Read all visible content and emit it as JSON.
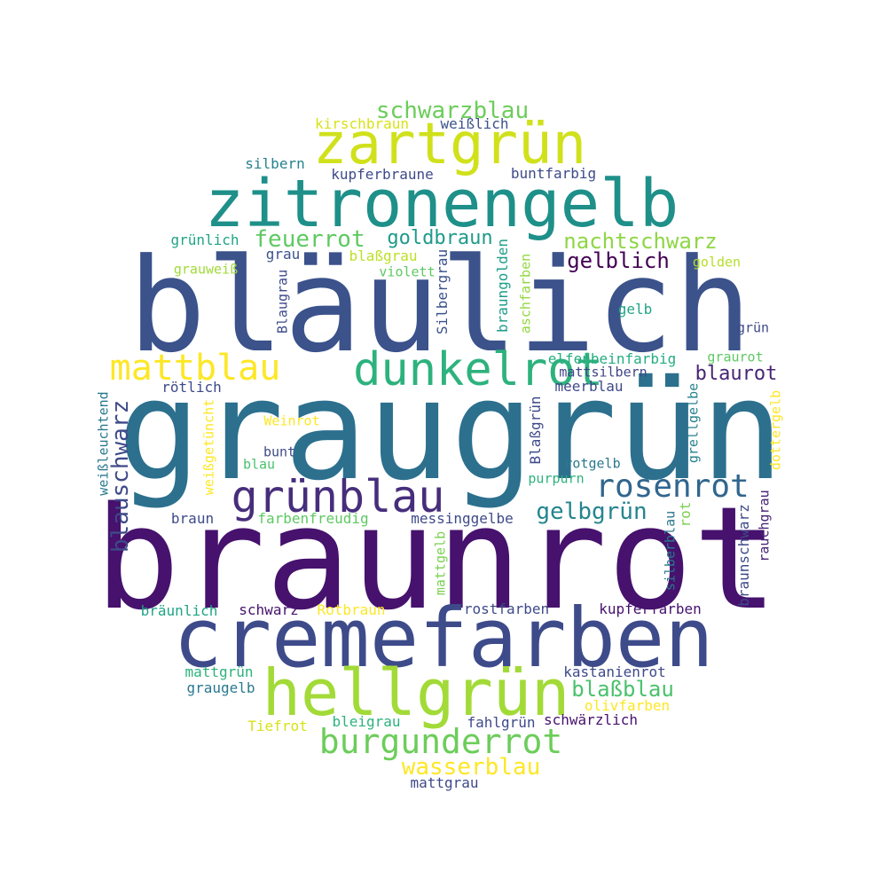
{
  "words": [
    {
      "id": "braunrot",
      "text": "braunrot",
      "color": "#46126d"
    },
    {
      "id": "graugruen",
      "text": "graugrün",
      "color": "#2c708e"
    },
    {
      "id": "blaeulich",
      "text": "bläulich",
      "color": "#3b528b"
    },
    {
      "id": "cremefarben",
      "text": "cremefarben",
      "color": "#3e4b8a"
    },
    {
      "id": "zitronengelb",
      "text": "zitronengelb",
      "color": "#1e9089"
    },
    {
      "id": "hellgruen",
      "text": "hellgrün",
      "color": "#a2da37"
    },
    {
      "id": "zartgruen",
      "text": "zartgrün",
      "color": "#d0e11c"
    },
    {
      "id": "dunkelrot",
      "text": "dunkelrot",
      "color": "#2db27d"
    },
    {
      "id": "gruenblau",
      "text": "grünblau",
      "color": "#472e7c"
    },
    {
      "id": "mattblau",
      "text": "mattblau",
      "color": "#fde725"
    },
    {
      "id": "burgunderrot",
      "text": "burgunderrot",
      "color": "#6ccd5a"
    },
    {
      "id": "rosenrot",
      "text": "rosenrot",
      "color": "#31668e"
    },
    {
      "id": "schwarzblau",
      "text": "schwarzblau",
      "color": "#6ccd5a"
    },
    {
      "id": "wasserblau",
      "text": "wasserblau",
      "color": "#fde725"
    },
    {
      "id": "blauschwarz",
      "text": "blauschwarz",
      "color": "#3e4a89"
    },
    {
      "id": "gelbgruen",
      "text": "gelbgrün",
      "color": "#25858e"
    },
    {
      "id": "nachtschwarz",
      "text": "nachtschwarz",
      "color": "#8ed645"
    },
    {
      "id": "feuerrot",
      "text": "feuerrot",
      "color": "#5ec962"
    },
    {
      "id": "goldbraun",
      "text": "goldbraun",
      "color": "#1f9a8a"
    },
    {
      "id": "gelblich",
      "text": "gelblich",
      "color": "#440154"
    },
    {
      "id": "blassblau",
      "text": "blaßblau",
      "color": "#4ac16d"
    },
    {
      "id": "blaurot",
      "text": "blaurot",
      "color": "#482475"
    },
    {
      "id": "kirschbraun",
      "text": "kirschbraun",
      "color": "#d8e219"
    },
    {
      "id": "weisslich",
      "text": "weißlich",
      "color": "#3b528b"
    },
    {
      "id": "silbern",
      "text": "silbern",
      "color": "#26828e"
    },
    {
      "id": "kupferbraune",
      "text": "kupferbraune",
      "color": "#3e4a89"
    },
    {
      "id": "buntfarbig",
      "text": "buntfarbig",
      "color": "#3e4a89"
    },
    {
      "id": "gruenlich",
      "text": "grünlich",
      "color": "#20a486"
    },
    {
      "id": "braungolden",
      "text": "braungolden",
      "color": "#1f9e89"
    },
    {
      "id": "grau",
      "text": "grau",
      "color": "#3b528b"
    },
    {
      "id": "blassgrau",
      "text": "blaßgrau",
      "color": "#bddf26"
    },
    {
      "id": "grauweiss",
      "text": "grauweiß",
      "color": "#a0da39"
    },
    {
      "id": "violett",
      "text": "violett",
      "color": "#5ec962"
    },
    {
      "id": "golden",
      "text": "golden",
      "color": "#b5de2b"
    },
    {
      "id": "silbergrau",
      "text": "Silbergrau",
      "color": "#3b528b"
    },
    {
      "id": "aschfarben",
      "text": "aschfarben",
      "color": "#93d741"
    },
    {
      "id": "blaugrau",
      "text": "Blaugrau",
      "color": "#3e4a89"
    },
    {
      "id": "gelb",
      "text": "gelb",
      "color": "#20a486"
    },
    {
      "id": "gruen",
      "text": "grün",
      "color": "#3e4a89"
    },
    {
      "id": "elfenbeinfarbig",
      "text": "elfenbeinfarbig",
      "color": "#25ac82"
    },
    {
      "id": "graurot",
      "text": "graurot",
      "color": "#5ec962"
    },
    {
      "id": "mattsilbern",
      "text": "mattsilbern",
      "color": "#414487"
    },
    {
      "id": "roetlich",
      "text": "rötlich",
      "color": "#3e4a89"
    },
    {
      "id": "meerblau",
      "text": "meerblau",
      "color": "#3e4a89"
    },
    {
      "id": "blassgruen",
      "text": "Blaßgrün",
      "color": "#3e4a89"
    },
    {
      "id": "grellgelbe",
      "text": "grellgelbe",
      "color": "#26828e"
    },
    {
      "id": "dottergelb",
      "text": "dottergelb",
      "color": "#fde725"
    },
    {
      "id": "weinrot",
      "text": "Weinrot",
      "color": "#fde725"
    },
    {
      "id": "weissleuchtend",
      "text": "weißleuchtend",
      "color": "#2a788e"
    },
    {
      "id": "weissgetuencht",
      "text": "weißgetüncht",
      "color": "#fde725"
    },
    {
      "id": "bunt",
      "text": "bunt",
      "color": "#3e4a89"
    },
    {
      "id": "blau",
      "text": "blau",
      "color": "#4ac16d"
    },
    {
      "id": "rotgelb",
      "text": "rotgelb",
      "color": "#2a788e"
    },
    {
      "id": "purpurn",
      "text": "purpurn",
      "color": "#2db27d"
    },
    {
      "id": "rot",
      "text": "rot",
      "color": "#7ad151"
    },
    {
      "id": "braun",
      "text": "braun",
      "color": "#3e4a89"
    },
    {
      "id": "farbenfreudig",
      "text": "farbenfreudig",
      "color": "#5ec962"
    },
    {
      "id": "messinggelbe",
      "text": "messinggelbe",
      "color": "#3e4a89"
    },
    {
      "id": "rauchgrau",
      "text": "rauchgrau",
      "color": "#482475"
    },
    {
      "id": "silberblau",
      "text": "silberblau",
      "color": "#2a788e"
    },
    {
      "id": "braunschwarz",
      "text": "braunschwarz",
      "color": "#3e4a89"
    },
    {
      "id": "mattgelb",
      "text": "mattgelb",
      "color": "#7ad151"
    },
    {
      "id": "braeunlich",
      "text": "bräunlich",
      "color": "#20a486"
    },
    {
      "id": "schwarz",
      "text": "schwarz",
      "color": "#46126d"
    },
    {
      "id": "rotbraun",
      "text": "Rotbraun",
      "color": "#fde725"
    },
    {
      "id": "rostfarben",
      "text": "rostfarben",
      "color": "#3e4a89"
    },
    {
      "id": "kupferfarben",
      "text": "kupferfarben",
      "color": "#46126d"
    },
    {
      "id": "mattgruen",
      "text": "mattgrün",
      "color": "#2db27d"
    },
    {
      "id": "kastanienrot",
      "text": "kastanienrot",
      "color": "#3e4a89"
    },
    {
      "id": "graugelb",
      "text": "graugelb",
      "color": "#2a788e"
    },
    {
      "id": "olivfarben",
      "text": "olivfarben",
      "color": "#fde725"
    },
    {
      "id": "bleigrau",
      "text": "bleigrau",
      "color": "#2db27d"
    },
    {
      "id": "fahlgruen",
      "text": "fahlgrün",
      "color": "#3e4a89"
    },
    {
      "id": "schwaerzlich",
      "text": "schwärzlich",
      "color": "#46126d"
    },
    {
      "id": "tiefrot",
      "text": "Tiefrot",
      "color": "#d8e219"
    },
    {
      "id": "mattgrau",
      "text": "mattgrau",
      "color": "#3e4a89"
    }
  ]
}
